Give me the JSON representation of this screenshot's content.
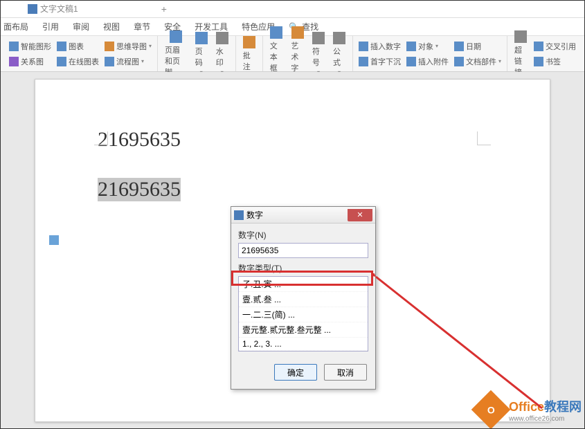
{
  "tab": {
    "doc_name": "文字文稿1",
    "plus": "+"
  },
  "ribbon": {
    "tabs": [
      "面布局",
      "引用",
      "审阅",
      "视图",
      "章节",
      "安全",
      "开发工具",
      "特色应用"
    ],
    "search": "查找"
  },
  "toolbar": {
    "group1": [
      "智能图形",
      "图表",
      "思维导图"
    ],
    "group1b": [
      "关系图",
      "在线图表",
      "流程图"
    ],
    "group2": [
      "页眉和页脚",
      "页码",
      "水印"
    ],
    "group3": [
      "批注"
    ],
    "group4": [
      "文本框",
      "艺术字",
      "符号",
      "公式"
    ],
    "group5": [
      "插入数字",
      "对象",
      "日期"
    ],
    "group5b": [
      "首字下沉",
      "插入附件",
      "文档部件"
    ],
    "group6": [
      "超链接",
      "交叉引用",
      "书签"
    ]
  },
  "document": {
    "line1": "21695635",
    "line2": "21695635"
  },
  "dialog": {
    "title": "数字",
    "label1": "数字(N)",
    "input_value": "21695635",
    "label2": "数字类型(T)",
    "options": [
      "子.丑.寅 ...",
      "壹.贰.叁 ...",
      "一.二.三(简) ...",
      "壹元整.贰元整.叁元整 ...",
      "1., 2., 3. ..."
    ],
    "ok": "确定",
    "cancel": "取消"
  },
  "watermark": {
    "brand1": "Office",
    "brand2": "教程网",
    "url": "www.office26.com"
  }
}
